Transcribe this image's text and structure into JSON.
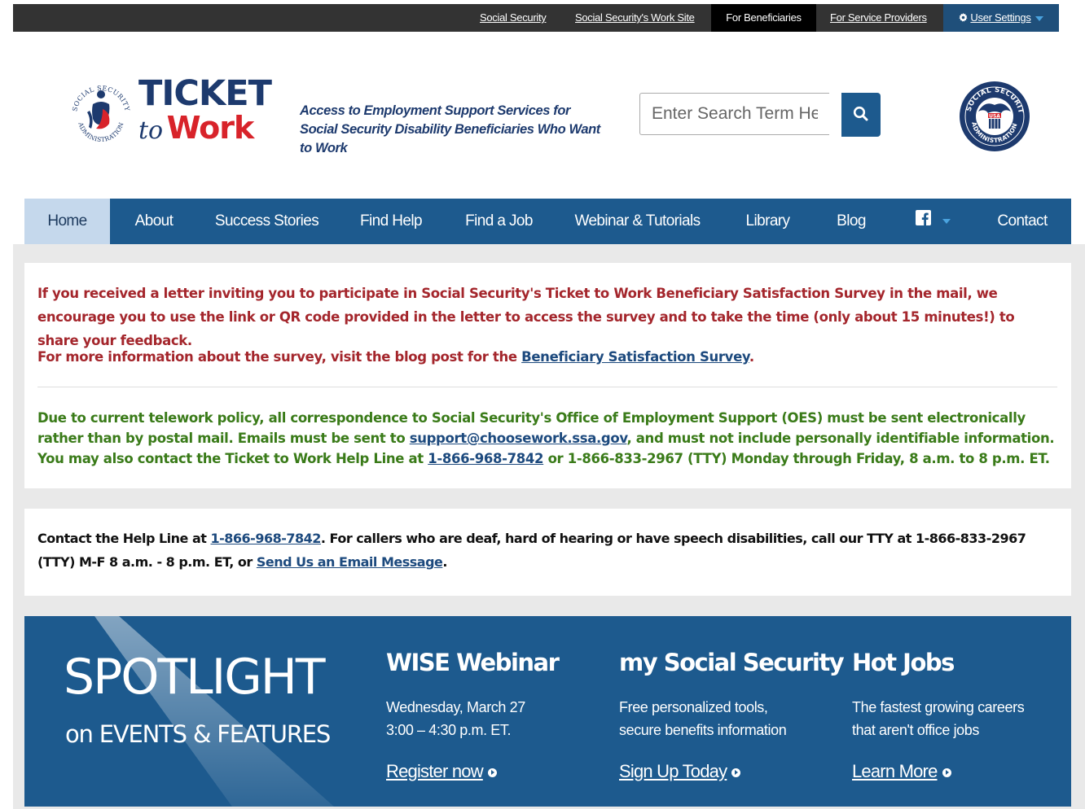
{
  "utility_nav": {
    "links": [
      {
        "label": "Social Security"
      },
      {
        "label": "Social Security's Work Site"
      },
      {
        "label": "For Beneficiaries"
      },
      {
        "label": "For Service Providers"
      }
    ],
    "settings_label": "User Settings",
    "settings_icon": "gear-icon"
  },
  "header": {
    "logo_line1": "TICKET",
    "logo_to": "to",
    "logo_work": "Work",
    "seal_text": "SOCIAL SECURITY ADMINISTRATION",
    "tagline": "Access to Employment Support Services for Social Security Disability Beneficiaries Who Want to Work",
    "search_placeholder": "Enter Search Term Here",
    "search_icon": "search-icon",
    "right_seal_top": "SOCIAL SECURITY",
    "right_seal_bottom": "ADMINISTRATION",
    "right_seal_usa": "USA"
  },
  "main_nav": {
    "items": [
      {
        "label": "Home"
      },
      {
        "label": "About"
      },
      {
        "label": "Success Stories"
      },
      {
        "label": "Find Help"
      },
      {
        "label": "Find a Job"
      },
      {
        "label": "Webinar & Tutorials"
      },
      {
        "label": "Library"
      },
      {
        "label": "Blog"
      },
      {
        "label": "Contact"
      }
    ],
    "social_icon": "facebook-icon"
  },
  "alerts": {
    "survey_text": "If you received a letter inviting you to participate in Social Security's Ticket to Work Beneficiary Satisfaction Survey in the mail, we encourage you to use the link or QR code provided in the letter to access the survey and to take the time (only about 15 minutes!) to share your feedback.",
    "survey_more_prefix": "For more information about the survey, visit the blog post for the ",
    "survey_more_link": "Beneficiary Satisfaction Survey",
    "survey_more_suffix": ".",
    "telework_part1": "Due to current telework policy, all correspondence to Social Security's Office of Employment Support (OES) must be sent electronically rather than by postal mail. Emails must be sent to ",
    "telework_email": "support@choosework.ssa.gov",
    "telework_part2": ", and must not include personally identifiable information. You may also contact the Ticket to Work Help Line at ",
    "telework_phone": "1-866-968-7842",
    "telework_part3": " or 1-866-833-2967 (TTY) Monday through Friday, 8 a.m. to 8 p.m. ET."
  },
  "contact": {
    "prefix": "Contact the Help Line at ",
    "phone": "1-866-968-7842",
    "middle": ". For callers who are deaf, hard of hearing or have speech disabilities, call our TTY at 1-866-833-2967 (TTY) M-F 8 a.m. - 8 p.m. ET, or ",
    "email_link": "Send Us an Email Message",
    "suffix": "."
  },
  "spotlight": {
    "title": "SPOTLIGHT",
    "subtitle": "on EVENTS & FEATURES",
    "features": [
      {
        "title": "WISE Webinar",
        "line1": "Wednesday, March 27",
        "line2": "3:00 – 4:30 p.m. ET.",
        "link": "Register now"
      },
      {
        "title": "my Social Security",
        "line1": "Free personalized tools,",
        "line2": "secure benefits information",
        "link": "Sign Up Today"
      },
      {
        "title": "Hot Jobs",
        "line1": "The fastest growing careers",
        "line2": "that aren't office jobs",
        "link": "Learn More"
      }
    ],
    "link_icon": "circle-arrow-icon"
  },
  "colors": {
    "nav_blue": "#1d5a8e",
    "alert_red": "#a4262c",
    "alert_green": "#3a7b19",
    "brand_red": "#d8232a",
    "brand_navy": "#1d3a6e"
  }
}
